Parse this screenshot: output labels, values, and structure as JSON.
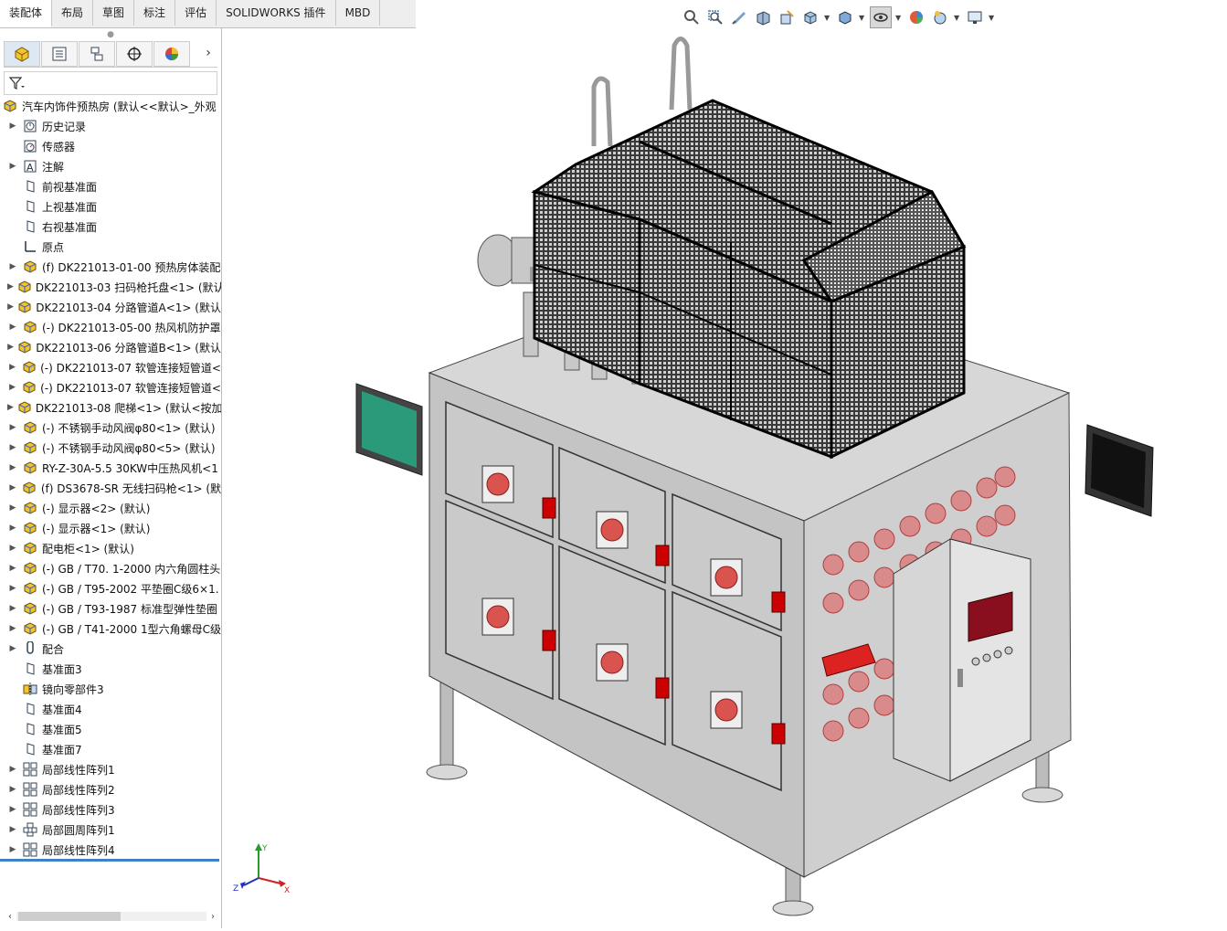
{
  "tabs": [
    {
      "label": "装配体",
      "active": true
    },
    {
      "label": "布局"
    },
    {
      "label": "草图"
    },
    {
      "label": "标注"
    },
    {
      "label": "评估"
    },
    {
      "label": "SOLIDWORKS 插件"
    },
    {
      "label": "MBD"
    }
  ],
  "tree": {
    "root": "汽车内饰件预热房 (默认<<默认>_外观",
    "items": [
      {
        "label": "历史记录",
        "icon": "history-icon",
        "expand": true
      },
      {
        "label": "传感器",
        "icon": "sensor-icon",
        "expand": false
      },
      {
        "label": "注解",
        "icon": "annotation-icon",
        "expand": true
      },
      {
        "label": "前视基准面",
        "icon": "plane-icon",
        "expand": false
      },
      {
        "label": "上视基准面",
        "icon": "plane-icon",
        "expand": false
      },
      {
        "label": "右视基准面",
        "icon": "plane-icon",
        "expand": false
      },
      {
        "label": "原点",
        "icon": "origin-icon",
        "expand": false
      },
      {
        "label": "(f) DK221013-01-00 预热房体装配",
        "icon": "subassembly-icon",
        "expand": true
      },
      {
        "label": "DK221013-03 扫码枪托盘<1> (默认",
        "icon": "subassembly-icon",
        "expand": true
      },
      {
        "label": "DK221013-04 分路管道A<1> (默认",
        "icon": "subassembly-icon",
        "expand": true
      },
      {
        "label": "(-) DK221013-05-00 热风机防护罩",
        "icon": "subassembly-icon",
        "expand": true
      },
      {
        "label": "DK221013-06 分路管道B<1> (默认",
        "icon": "subassembly-icon",
        "expand": true
      },
      {
        "label": "(-) DK221013-07 软管连接短管道<",
        "icon": "subassembly-icon",
        "expand": true
      },
      {
        "label": "(-) DK221013-07 软管连接短管道<",
        "icon": "subassembly-icon",
        "expand": true
      },
      {
        "label": "DK221013-08 爬梯<1> (默认<按加",
        "icon": "subassembly-icon",
        "expand": true
      },
      {
        "label": "(-) 不锈钢手动风阀φ80<1> (默认)",
        "icon": "subassembly-icon",
        "expand": true
      },
      {
        "label": "(-) 不锈钢手动风阀φ80<5> (默认)",
        "icon": "subassembly-icon",
        "expand": true
      },
      {
        "label": "RY-Z-30A-5.5 30KW中压热风机<1",
        "icon": "subassembly-icon",
        "expand": true
      },
      {
        "label": "(f) DS3678-SR 无线扫码枪<1> (默",
        "icon": "subassembly-icon",
        "expand": true
      },
      {
        "label": "(-) 显示器<2> (默认)",
        "icon": "subassembly-icon",
        "expand": true
      },
      {
        "label": "(-) 显示器<1> (默认)",
        "icon": "subassembly-icon",
        "expand": true
      },
      {
        "label": "配电柜<1> (默认)",
        "icon": "subassembly-icon",
        "expand": true
      },
      {
        "label": "(-) GB / T70. 1-2000 内六角圆柱头",
        "icon": "subassembly-icon",
        "expand": true
      },
      {
        "label": "(-) GB / T95-2002 平垫圈C级6×1.",
        "icon": "subassembly-icon",
        "expand": true
      },
      {
        "label": "(-) GB / T93-1987 标准型弹性垫圈",
        "icon": "subassembly-icon",
        "expand": true
      },
      {
        "label": "(-) GB / T41-2000 1型六角螺母C级",
        "icon": "subassembly-icon",
        "expand": true
      },
      {
        "label": "配合",
        "icon": "mates-icon",
        "expand": true
      },
      {
        "label": "基准面3",
        "icon": "plane-icon",
        "expand": false
      },
      {
        "label": "镜向零部件3",
        "icon": "mirror-icon",
        "expand": false
      },
      {
        "label": "基准面4",
        "icon": "plane-icon",
        "expand": false
      },
      {
        "label": "基准面5",
        "icon": "plane-icon",
        "expand": false
      },
      {
        "label": "基准面7",
        "icon": "plane-icon",
        "expand": false
      },
      {
        "label": "局部线性阵列1",
        "icon": "pattern-icon",
        "expand": true
      },
      {
        "label": "局部线性阵列2",
        "icon": "pattern-icon",
        "expand": true
      },
      {
        "label": "局部线性阵列3",
        "icon": "pattern-icon",
        "expand": true
      },
      {
        "label": "局部圆周阵列1",
        "icon": "circular-pattern-icon",
        "expand": true
      },
      {
        "label": "局部线性阵列4",
        "icon": "pattern-icon",
        "expand": true
      }
    ]
  },
  "triad": {
    "x": "X",
    "y": "Y",
    "z": "Z"
  },
  "colors": {
    "accent": "#3d82c4",
    "machine_frame": "#b0b0b0",
    "fan_red": "#d9534f",
    "monitor_screen": "#2a9a7a"
  }
}
